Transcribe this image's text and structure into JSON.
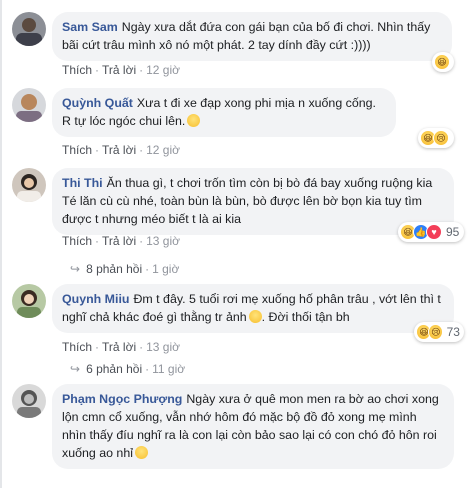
{
  "colors": {
    "author": "#385898",
    "bubble": "#f2f3f5",
    "muted": "#90949c"
  },
  "comments": [
    {
      "author": "Sam Sam",
      "text": "Ngày xưa dắt đứa con gái bạn của bố đi chơi. Nhìn thấy bãi cứt trâu mình xô nó một phát. 2 tay dính đầy cứt :))))",
      "like": "Thích",
      "reply": "Trả lời",
      "time": "12 giờ",
      "reactions": [
        "haha"
      ],
      "count": ""
    },
    {
      "author": "Quỳnh Quất",
      "text": "Xưa t đi xe đạp xong phi mịa n xuống cống. R tự lóc ngóc chui lên.",
      "like": "Thích",
      "reply": "Trả lời",
      "time": "12 giờ",
      "reactions": [
        "haha",
        "sad"
      ],
      "count": ""
    },
    {
      "author": "Thi Thi",
      "text": "Ăn thua gì, t chơi trốn tìm còn bị bò đá bay xuống ruộng kia Té lăn cù cù nhé, toàn bùn là bùn, bò được lên bờ bọn kia tuy tìm được t nhưng méo biết t là ai kia",
      "like": "Thích",
      "reply": "Trả lời",
      "time": "13 giờ",
      "reactions": [
        "haha",
        "like",
        "love"
      ],
      "count": "95",
      "replies": {
        "label": "8 phản hồi",
        "time": "1 giờ"
      }
    },
    {
      "author": "Quynh Miiu",
      "text": "Đm t đây. 5 tuổi rơi mẹ xuống hố phân trâu , vớt lên thì t nghĩ chả khác đoé gì thằng tr ảnh",
      "text2": ". Đời thối tận bh",
      "like": "Thích",
      "reply": "Trả lời",
      "time": "13 giờ",
      "reactions": [
        "haha",
        "sad"
      ],
      "count": "73",
      "replies": {
        "label": "6 phản hồi",
        "time": "11 giờ"
      }
    },
    {
      "author": "Phạm Ngọc Phượng",
      "text": "Ngày xưa ở quê mon men ra bờ ao chơi xong lộn cmn cổ xuống, vẫn nhớ hôm đó mặc bộ đồ đỏ xong mẹ mình nhìn thấy đíu nghĩ ra là con lại còn bảo sao lại có con chó đỏ hôn roi xuống ao nhỉ",
      "like": "",
      "reply": "",
      "time": ""
    }
  ]
}
